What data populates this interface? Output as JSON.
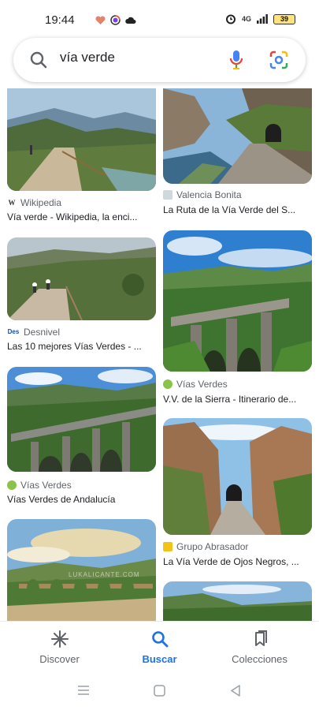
{
  "status_bar": {
    "time": "19:44",
    "battery": "39",
    "network": "4G"
  },
  "search": {
    "query": "vía verde"
  },
  "results_left": [
    {
      "source": "Wikipedia",
      "favicon": "W",
      "title": "Vía verde - Wikipedia, la enci..."
    },
    {
      "source": "Desnivel",
      "favicon": "Des",
      "title": "Las 10 mejores Vías Verdes - ..."
    },
    {
      "source": "Vías Verdes",
      "favicon": "vv",
      "title": "Vías Verdes de Andalucía"
    },
    {
      "source": "",
      "favicon": "",
      "title": ""
    }
  ],
  "results_right": [
    {
      "source": "Valencia Bonita",
      "favicon": "vb",
      "title": "La Ruta de la Vía Verde del S..."
    },
    {
      "source": "Vías Verdes",
      "favicon": "vv",
      "title": "V.V. de la Sierra - Itinerario de..."
    },
    {
      "source": "Grupo Abrasador",
      "favicon": "ga",
      "title": "La Vía Verde de Ojos Negros, ..."
    },
    {
      "source": "",
      "favicon": "",
      "title": ""
    }
  ],
  "watermark": "LUKALICANTE.COM",
  "bottom_nav": [
    {
      "label": "Discover",
      "icon": "asterisk-icon",
      "active": false
    },
    {
      "label": "Buscar",
      "icon": "search-icon",
      "active": true
    },
    {
      "label": "Colecciones",
      "icon": "bookmarks-icon",
      "active": false
    }
  ],
  "colors": {
    "accent": "#1a73e8",
    "text": "#202124",
    "secondary": "#5f6368"
  }
}
